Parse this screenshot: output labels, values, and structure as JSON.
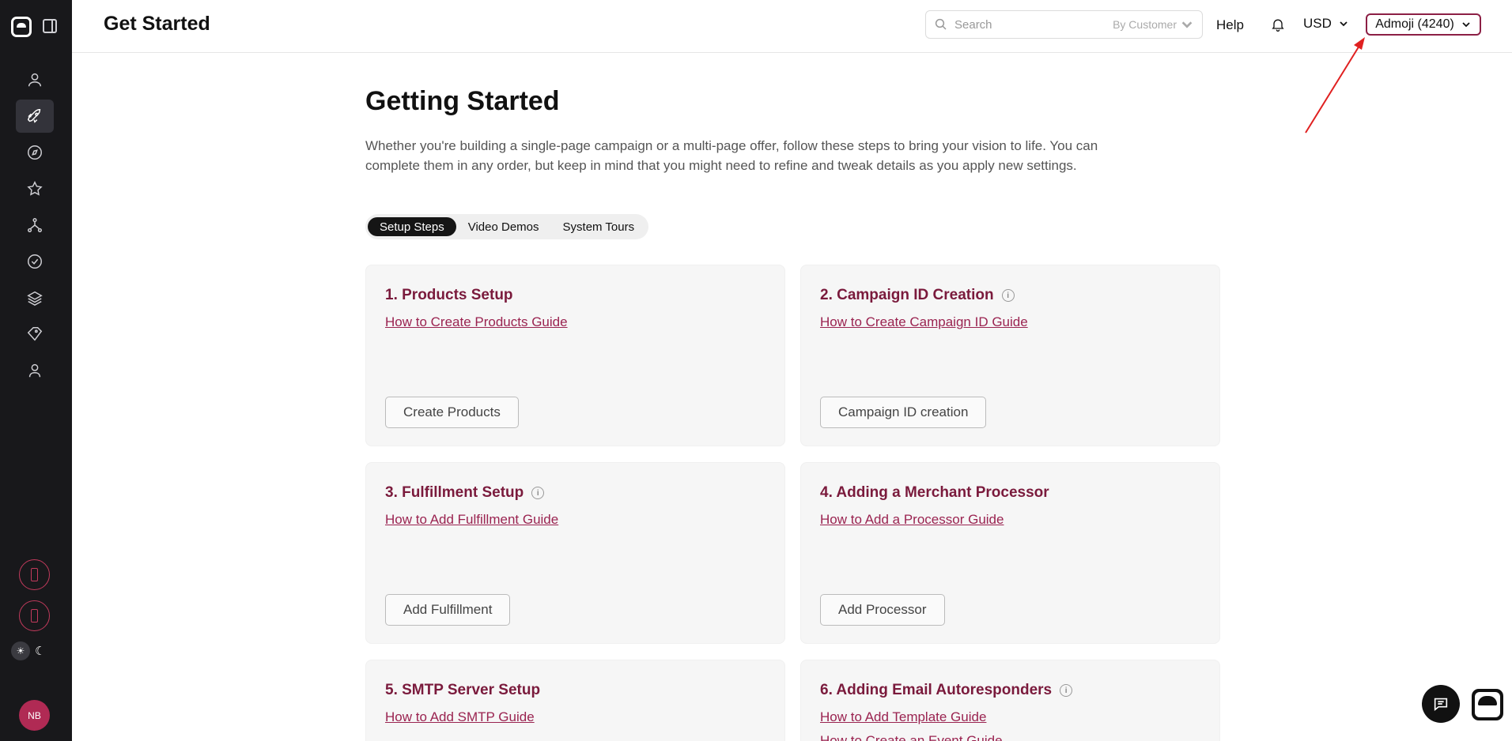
{
  "header": {
    "title": "Get Started",
    "search_placeholder": "Search",
    "search_filter": "By Customer",
    "help_label": "Help",
    "currency": "USD",
    "account": "Admoji (4240)"
  },
  "sidebar": {
    "items": [
      {
        "icon": "user-icon"
      },
      {
        "icon": "rocket-icon",
        "active": true
      },
      {
        "icon": "compass-icon"
      },
      {
        "icon": "star-icon"
      },
      {
        "icon": "network-icon"
      },
      {
        "icon": "check-circle-icon"
      },
      {
        "icon": "layers-icon"
      },
      {
        "icon": "tag-icon"
      },
      {
        "icon": "user-alt-icon"
      }
    ],
    "avatar_initials": "NB"
  },
  "main": {
    "heading": "Getting Started",
    "intro": "Whether you're building a single-page campaign or a multi-page offer, follow these steps to bring your vision to life. You can complete them in any order, but keep in mind that you might need to refine and tweak details as you apply new settings.",
    "tabs": [
      {
        "label": "Setup Steps",
        "active": true
      },
      {
        "label": "Video Demos"
      },
      {
        "label": "System Tours"
      }
    ],
    "cards": [
      {
        "title": "1. Products Setup",
        "info": false,
        "links": [
          "How to Create Products Guide"
        ],
        "button": "Create Products"
      },
      {
        "title": "2. Campaign ID Creation",
        "info": true,
        "links": [
          "How to Create Campaign ID Guide"
        ],
        "button": "Campaign ID creation"
      },
      {
        "title": "3. Fulfillment Setup",
        "info": true,
        "links": [
          "How to Add Fulfillment Guide"
        ],
        "button": "Add Fulfillment"
      },
      {
        "title": "4. Adding a Merchant Processor",
        "info": false,
        "links": [
          "How to Add a Processor Guide"
        ],
        "button": "Add Processor"
      },
      {
        "title": "5. SMTP Server Setup",
        "info": false,
        "links": [
          "How to Add SMTP Guide"
        ],
        "button": ""
      },
      {
        "title": "6. Adding Email Autoresponders",
        "info": true,
        "links": [
          "How to Add Template Guide",
          "How to Create an Event Guide"
        ],
        "button": ""
      }
    ]
  },
  "colors": {
    "sidebar_bg": "#18181b",
    "accent": "#7a1a3c",
    "link": "#9a2350",
    "annotation_arrow": "#e02020"
  }
}
